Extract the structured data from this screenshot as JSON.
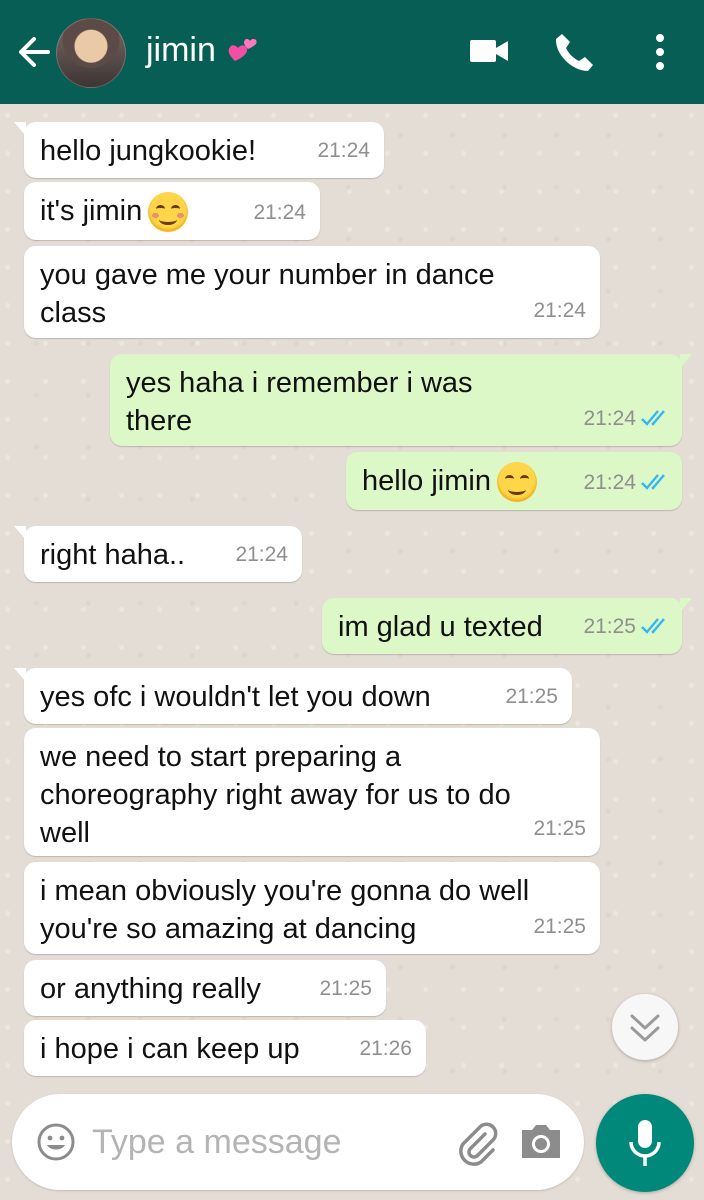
{
  "header": {
    "contact_name": "jimin",
    "emoji_icon": "two-hearts-icon",
    "color": "#075e54"
  },
  "messages": [
    {
      "dir": "in",
      "text": "hello jungkookie!",
      "time": "21:24"
    },
    {
      "dir": "in",
      "text": "it's jimin",
      "emoji": "smiling-face-icon",
      "time": "21:24"
    },
    {
      "dir": "in",
      "text": "you gave me your number in dance class",
      "time": "21:24"
    },
    {
      "dir": "out",
      "text": "yes haha i remember i was there",
      "time": "21:24",
      "status": "read"
    },
    {
      "dir": "out",
      "text": "hello jimin",
      "emoji": "smiley-icon",
      "time": "21:24",
      "status": "read"
    },
    {
      "dir": "in",
      "text": "right haha..",
      "time": "21:24"
    },
    {
      "dir": "out",
      "text": "im glad u texted",
      "time": "21:25",
      "status": "read"
    },
    {
      "dir": "in",
      "text": "yes ofc i wouldn't let you down",
      "time": "21:25"
    },
    {
      "dir": "in",
      "text": "we need to start preparing a choreography right away for us to do well",
      "time": "21:25"
    },
    {
      "dir": "in",
      "text": "i mean obviously you're gonna do well you're so amazing at dancing",
      "time": "21:25"
    },
    {
      "dir": "in",
      "text": "or anything really",
      "time": "21:25"
    },
    {
      "dir": "in",
      "text": "i hope i can keep up",
      "time": "21:26"
    }
  ],
  "composer": {
    "placeholder": "Type a message",
    "mic_color": "#00897b"
  },
  "colors": {
    "incoming_bubble": "#ffffff",
    "outgoing_bubble": "#dcf8c6",
    "read_tick": "#34b7f1",
    "wallpaper": "#e5ded6"
  }
}
